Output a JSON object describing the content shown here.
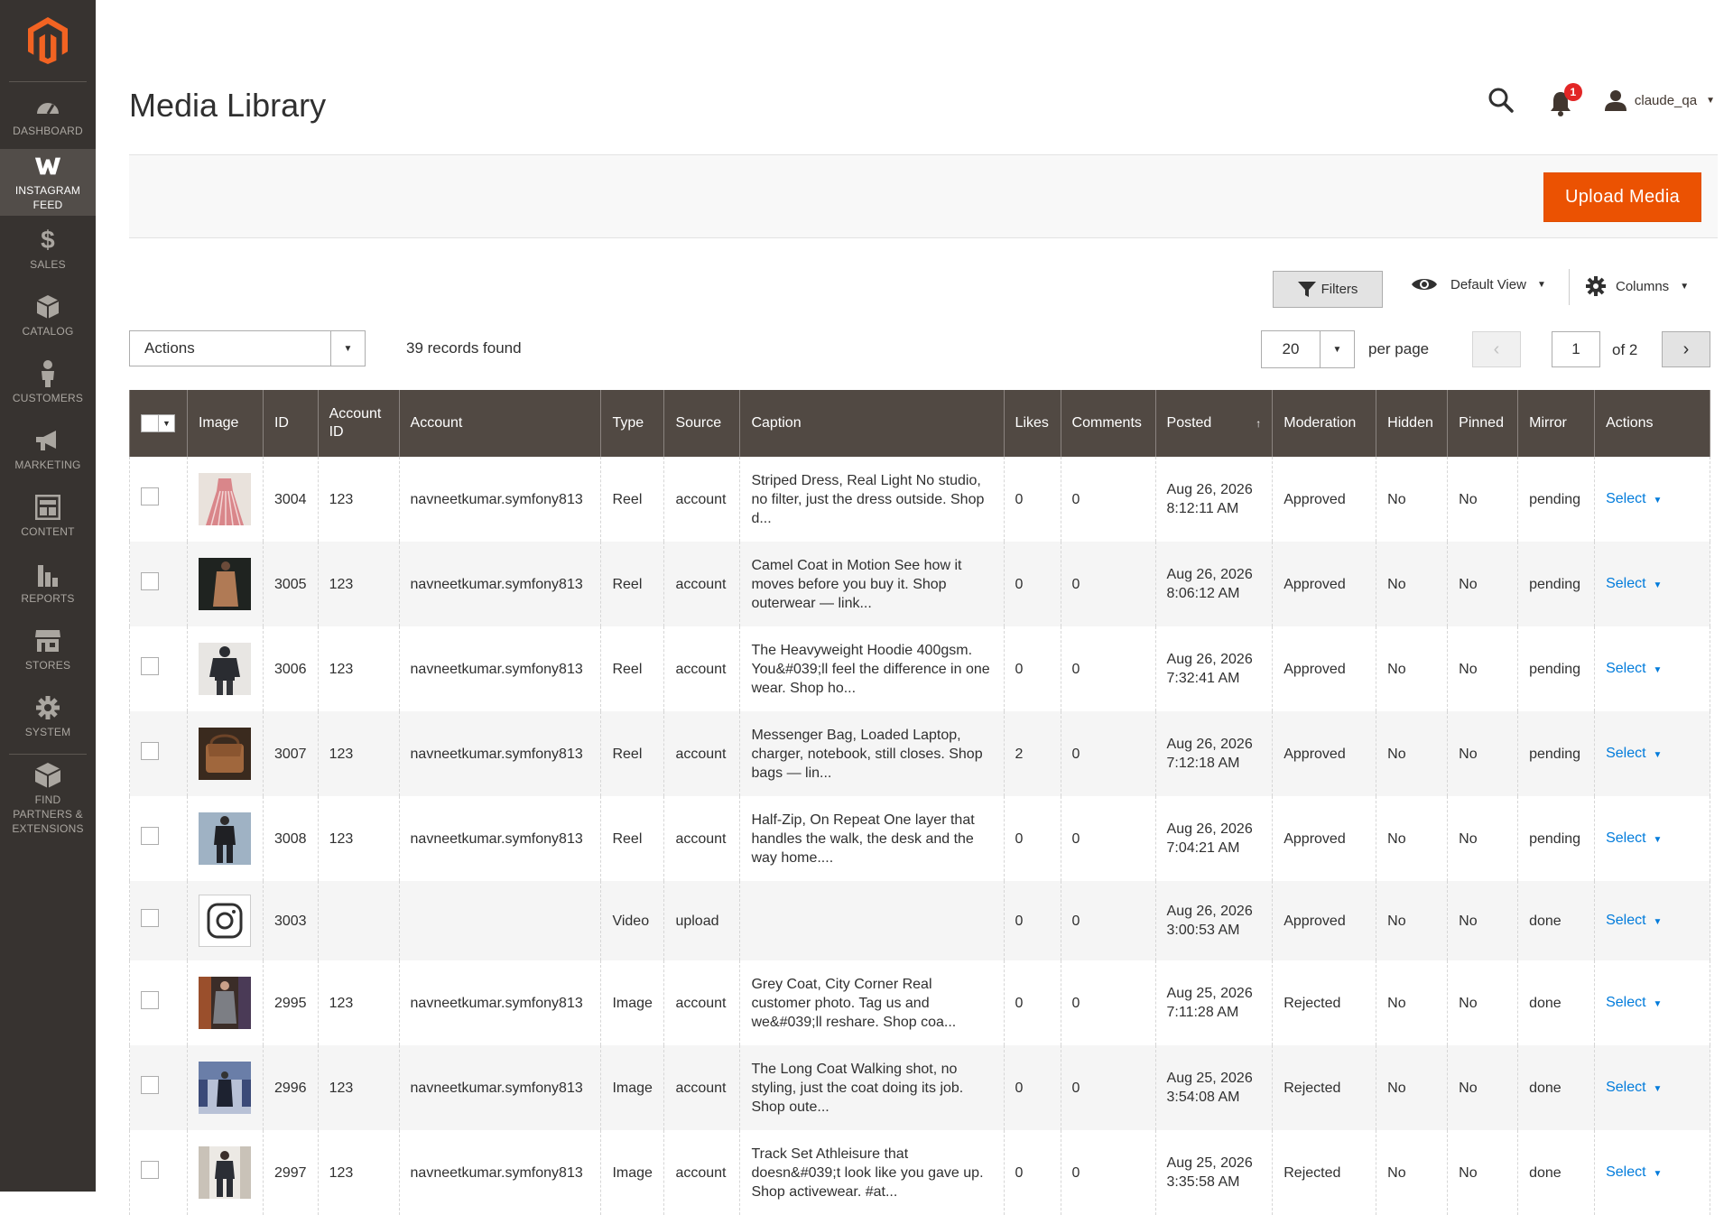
{
  "sidebar": {
    "items": [
      {
        "label": "Dashboard",
        "icon": "dashboard-icon",
        "active": false
      },
      {
        "label": "Instagram Feed",
        "icon": "instagram-feed-icon",
        "active": true
      },
      {
        "label": "Sales",
        "icon": "dollar-icon",
        "active": false
      },
      {
        "label": "Catalog",
        "icon": "box-icon",
        "active": false
      },
      {
        "label": "Customers",
        "icon": "person-icon",
        "active": false
      },
      {
        "label": "Marketing",
        "icon": "megaphone-icon",
        "active": false
      },
      {
        "label": "Content",
        "icon": "layout-icon",
        "active": false
      },
      {
        "label": "Reports",
        "icon": "bar-chart-icon",
        "active": false
      },
      {
        "label": "Stores",
        "icon": "store-icon",
        "active": false
      },
      {
        "label": "System",
        "icon": "gear-icon",
        "active": false
      },
      {
        "label": "Find Partners & Extensions",
        "icon": "extensions-icon",
        "active": false
      }
    ]
  },
  "header": {
    "title": "Media Library",
    "notification_count": "1",
    "username": "claude_qa"
  },
  "action_bar": {
    "upload_label": "Upload Media"
  },
  "controls": {
    "filters_label": "Filters",
    "view_label": "Default View",
    "columns_label": "Columns",
    "actions_label": "Actions",
    "records_text": "39 records found",
    "per_page_value": "20",
    "per_page_label": "per page",
    "current_page": "1",
    "total_pages_text": "of 2"
  },
  "colors": {
    "accent": "#eb5202",
    "sidebar_bg": "#373330",
    "table_header_bg": "#514943",
    "link": "#007bdb",
    "badge": "#e22626"
  },
  "table": {
    "columns": [
      "Image",
      "ID",
      "Account ID",
      "Account",
      "Type",
      "Source",
      "Caption",
      "Likes",
      "Comments",
      "Posted",
      "Moderation",
      "Hidden",
      "Pinned",
      "Mirror",
      "Actions"
    ],
    "sort_indicator": "↑",
    "rows": [
      {
        "id": "3004",
        "account_id": "123",
        "account": "navneetkumar.symfony813",
        "type": "Reel",
        "source": "account",
        "caption": "Striped Dress, Real Light No studio, no filter, just the dress outside. Shop d...",
        "likes": "0",
        "comments": "0",
        "posted_date": "Aug 26, 2026",
        "posted_time": "8:12:11 AM",
        "moderation": "Approved",
        "hidden": "No",
        "pinned": "No",
        "mirror": "pending",
        "action": "Select",
        "thumb": "pink-dress"
      },
      {
        "id": "3005",
        "account_id": "123",
        "account": "navneetkumar.symfony813",
        "type": "Reel",
        "source": "account",
        "caption": "Camel Coat in Motion See how it moves before you buy it. Shop outerwear — link...",
        "likes": "0",
        "comments": "0",
        "posted_date": "Aug 26, 2026",
        "posted_time": "8:06:12 AM",
        "moderation": "Approved",
        "hidden": "No",
        "pinned": "No",
        "mirror": "pending",
        "action": "Select",
        "thumb": "camel-coat"
      },
      {
        "id": "3006",
        "account_id": "123",
        "account": "navneetkumar.symfony813",
        "type": "Reel",
        "source": "account",
        "caption": "The Heavyweight Hoodie 400gsm. You&#039;ll feel the difference in one wear. Shop ho...",
        "likes": "0",
        "comments": "0",
        "posted_date": "Aug 26, 2026",
        "posted_time": "7:32:41 AM",
        "moderation": "Approved",
        "hidden": "No",
        "pinned": "No",
        "mirror": "pending",
        "action": "Select",
        "thumb": "hoodie"
      },
      {
        "id": "3007",
        "account_id": "123",
        "account": "navneetkumar.symfony813",
        "type": "Reel",
        "source": "account",
        "caption": "Messenger Bag, Loaded Laptop, charger, notebook, still closes. Shop bags — lin...",
        "likes": "2",
        "comments": "0",
        "posted_date": "Aug 26, 2026",
        "posted_time": "7:12:18 AM",
        "moderation": "Approved",
        "hidden": "No",
        "pinned": "No",
        "mirror": "pending",
        "action": "Select",
        "thumb": "bag"
      },
      {
        "id": "3008",
        "account_id": "123",
        "account": "navneetkumar.symfony813",
        "type": "Reel",
        "source": "account",
        "caption": "Half-Zip, On Repeat One layer that handles the walk, the desk and the way home....",
        "likes": "0",
        "comments": "0",
        "posted_date": "Aug 26, 2026",
        "posted_time": "7:04:21 AM",
        "moderation": "Approved",
        "hidden": "No",
        "pinned": "No",
        "mirror": "pending",
        "action": "Select",
        "thumb": "half-zip"
      },
      {
        "id": "3003",
        "account_id": "",
        "account": "",
        "type": "Video",
        "source": "upload",
        "caption": "",
        "likes": "0",
        "comments": "0",
        "posted_date": "Aug 26, 2026",
        "posted_time": "3:00:53 AM",
        "moderation": "Approved",
        "hidden": "No",
        "pinned": "No",
        "mirror": "done",
        "action": "Select",
        "thumb": "instagram-placeholder"
      },
      {
        "id": "2995",
        "account_id": "123",
        "account": "navneetkumar.symfony813",
        "type": "Image",
        "source": "account",
        "caption": "Grey Coat, City Corner Real customer photo. Tag us and we&#039;ll reshare. Shop coa...",
        "likes": "0",
        "comments": "0",
        "posted_date": "Aug 25, 2026",
        "posted_time": "7:11:28 AM",
        "moderation": "Rejected",
        "hidden": "No",
        "pinned": "No",
        "mirror": "done",
        "action": "Select",
        "thumb": "grey-coat"
      },
      {
        "id": "2996",
        "account_id": "123",
        "account": "navneetkumar.symfony813",
        "type": "Image",
        "source": "account",
        "caption": "The Long Coat Walking shot, no styling, just the coat doing its job. Shop oute...",
        "likes": "0",
        "comments": "0",
        "posted_date": "Aug 25, 2026",
        "posted_time": "3:54:08 AM",
        "moderation": "Rejected",
        "hidden": "No",
        "pinned": "No",
        "mirror": "done",
        "action": "Select",
        "thumb": "long-coat"
      },
      {
        "id": "2997",
        "account_id": "123",
        "account": "navneetkumar.symfony813",
        "type": "Image",
        "source": "account",
        "caption": "Track Set Athleisure that doesn&#039;t look like you gave up. Shop activewear. #at...",
        "likes": "0",
        "comments": "0",
        "posted_date": "Aug 25, 2026",
        "posted_time": "3:35:58 AM",
        "moderation": "Rejected",
        "hidden": "No",
        "pinned": "No",
        "mirror": "done",
        "action": "Select",
        "thumb": "track-set"
      }
    ]
  }
}
